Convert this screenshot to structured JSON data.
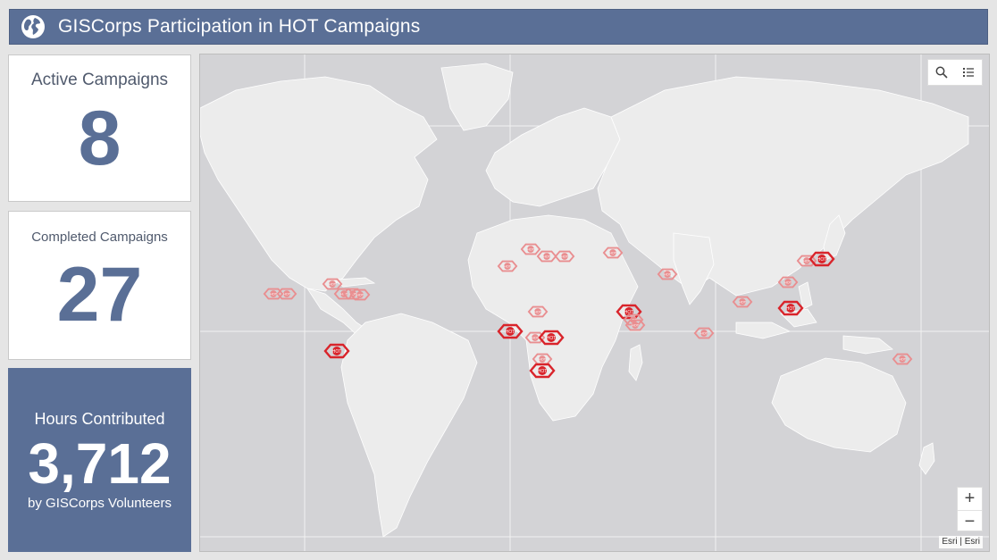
{
  "header": {
    "title": "GISCorps Participation in HOT Campaigns",
    "icon": "globe-icon"
  },
  "cards": {
    "active": {
      "label": "Active Campaigns",
      "value": "8"
    },
    "completed": {
      "label": "Completed Campaigns",
      "value": "27"
    },
    "hours": {
      "label": "Hours Contributed",
      "value": "3,712",
      "sub": "by GISCorps Volunteers"
    }
  },
  "map": {
    "tools": [
      "search-icon",
      "legend-icon"
    ],
    "zoom_in": "+",
    "zoom_out": "−",
    "attribution": "Esri | Esri",
    "marker_text": "HOT",
    "colors": {
      "active": "#d9242b",
      "completed": "#e98e90",
      "land": "#ececec",
      "water": "#d3d3d6"
    },
    "markers": [
      {
        "lon": -104,
        "lat": 19,
        "status": "completed"
      },
      {
        "lon": -98,
        "lat": 19,
        "status": "completed"
      },
      {
        "lon": -78,
        "lat": 24,
        "status": "completed"
      },
      {
        "lon": -73,
        "lat": 19,
        "status": "completed"
      },
      {
        "lon": -69,
        "lat": 19,
        "status": "completed"
      },
      {
        "lon": -66,
        "lat": 18.5,
        "status": "completed"
      },
      {
        "lon": -76,
        "lat": -10,
        "status": "active"
      },
      {
        "lon": -1,
        "lat": 33,
        "status": "completed"
      },
      {
        "lon": 9,
        "lat": 42,
        "status": "completed"
      },
      {
        "lon": 16,
        "lat": 38,
        "status": "completed"
      },
      {
        "lon": 24,
        "lat": 38,
        "status": "completed"
      },
      {
        "lon": 45,
        "lat": 40,
        "status": "completed"
      },
      {
        "lon": 69,
        "lat": 29,
        "status": "completed"
      },
      {
        "lon": 12,
        "lat": 10,
        "status": "completed"
      },
      {
        "lon": 0,
        "lat": 0,
        "status": "active"
      },
      {
        "lon": 11,
        "lat": -3,
        "status": "completed"
      },
      {
        "lon": 18,
        "lat": -3,
        "status": "active"
      },
      {
        "lon": 14,
        "lat": -14,
        "status": "completed"
      },
      {
        "lon": 14,
        "lat": -20,
        "status": "active"
      },
      {
        "lon": 52,
        "lat": 10,
        "status": "active"
      },
      {
        "lon": 54,
        "lat": 6,
        "status": "completed"
      },
      {
        "lon": 55,
        "lat": 3,
        "status": "completed"
      },
      {
        "lon": 102,
        "lat": 15,
        "status": "completed"
      },
      {
        "lon": 85,
        "lat": -1,
        "status": "completed"
      },
      {
        "lon": 122,
        "lat": 25,
        "status": "completed"
      },
      {
        "lon": 123,
        "lat": 12,
        "status": "active"
      },
      {
        "lon": 130,
        "lat": 36,
        "status": "completed"
      },
      {
        "lon": 137,
        "lat": 37,
        "status": "active"
      },
      {
        "lon": 172,
        "lat": -14,
        "status": "completed"
      }
    ]
  }
}
